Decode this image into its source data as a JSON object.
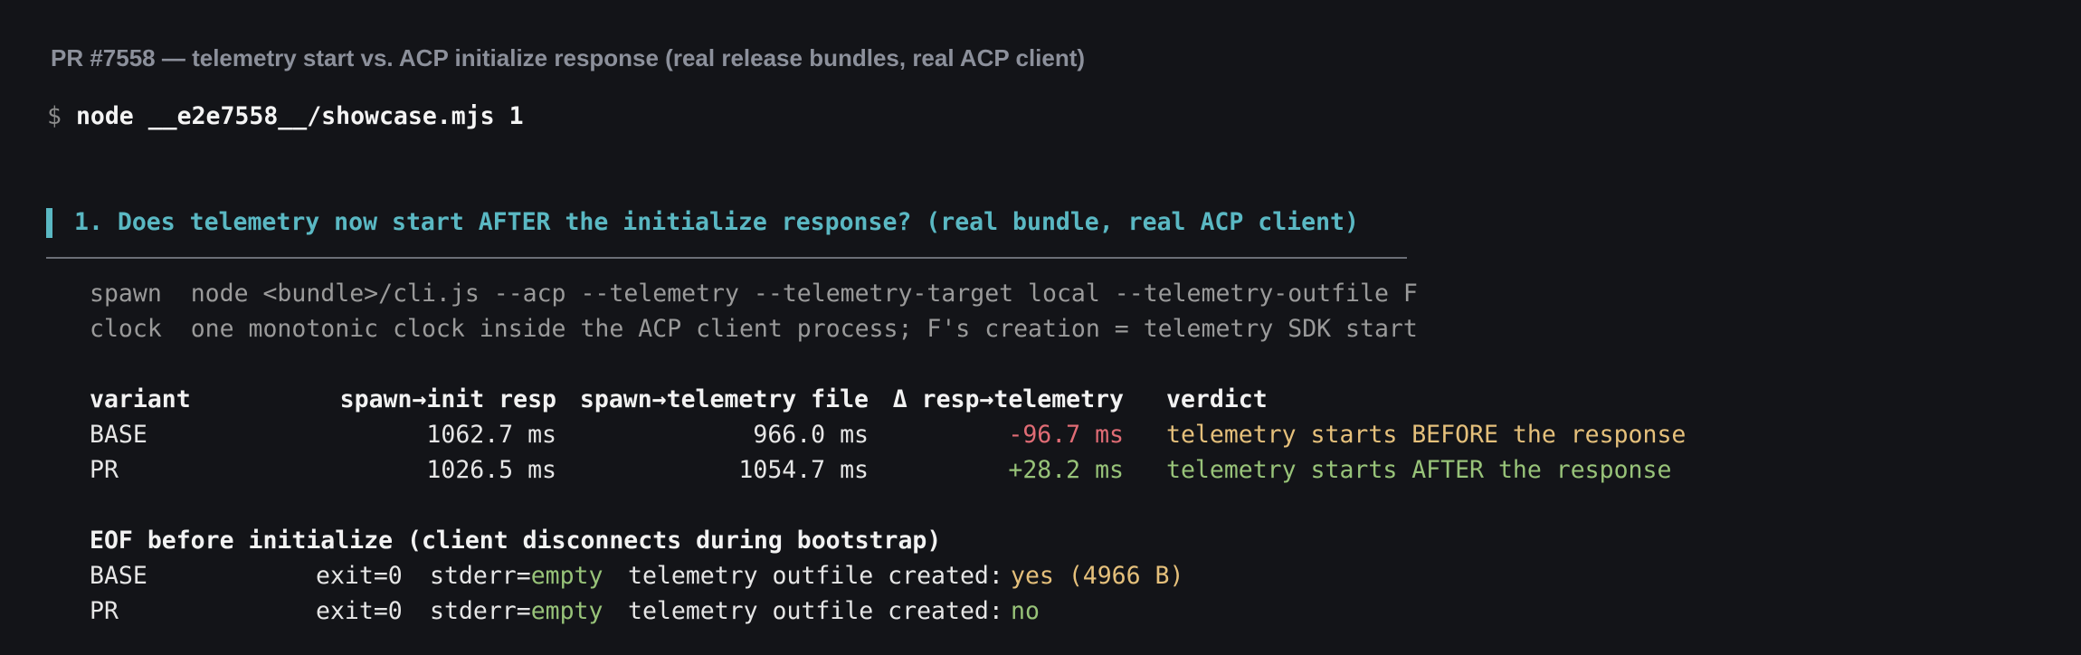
{
  "window": {
    "title": "PR #7558 — telemetry start vs. ACP initialize response (real release bundles, real ACP client)"
  },
  "command": {
    "prompt": "$",
    "text": "node __e2e7558__/showcase.mjs 1"
  },
  "section": {
    "title": "1. Does telemetry now start AFTER the initialize response? (real bundle, real ACP client)"
  },
  "info": [
    {
      "key": "spawn",
      "value": "node <bundle>/cli.js --acp --telemetry --telemetry-target local --telemetry-outfile F"
    },
    {
      "key": "clock",
      "value": "one monotonic clock inside the ACP client process; F's creation = telemetry SDK start"
    }
  ],
  "timing_table": {
    "headers": [
      "variant",
      "spawn→init resp",
      "spawn→telemetry file",
      "Δ resp→telemetry",
      "verdict"
    ],
    "rows": [
      {
        "variant": "BASE",
        "init_resp": "1062.7 ms",
        "telemetry_file": "966.0 ms",
        "delta": "-96.7 ms",
        "verdict": "telemetry starts BEFORE the response",
        "status_color": "#e06c75",
        "verdict_color": "#e5c07b"
      },
      {
        "variant": "PR",
        "init_resp": "1026.5 ms",
        "telemetry_file": "1054.7 ms",
        "delta": "+28.2 ms",
        "verdict": "telemetry starts AFTER the response",
        "status_color": "#98c379",
        "verdict_color": "#98c379"
      }
    ]
  },
  "eof_section": {
    "title": "EOF before initialize (client disconnects during bootstrap)",
    "rows": [
      {
        "variant": "BASE",
        "exit": "exit=0",
        "stderr_label": "stderr=",
        "stderr_value": "empty",
        "outfile_label": "telemetry outfile created:",
        "outfile_value": "yes (4966 B)",
        "outfile_color": "#e5c07b"
      },
      {
        "variant": "PR",
        "exit": "exit=0",
        "stderr_label": "stderr=",
        "stderr_value": "empty",
        "outfile_label": "telemetry outfile created:",
        "outfile_value": "no",
        "outfile_color": "#98c379"
      }
    ]
  }
}
